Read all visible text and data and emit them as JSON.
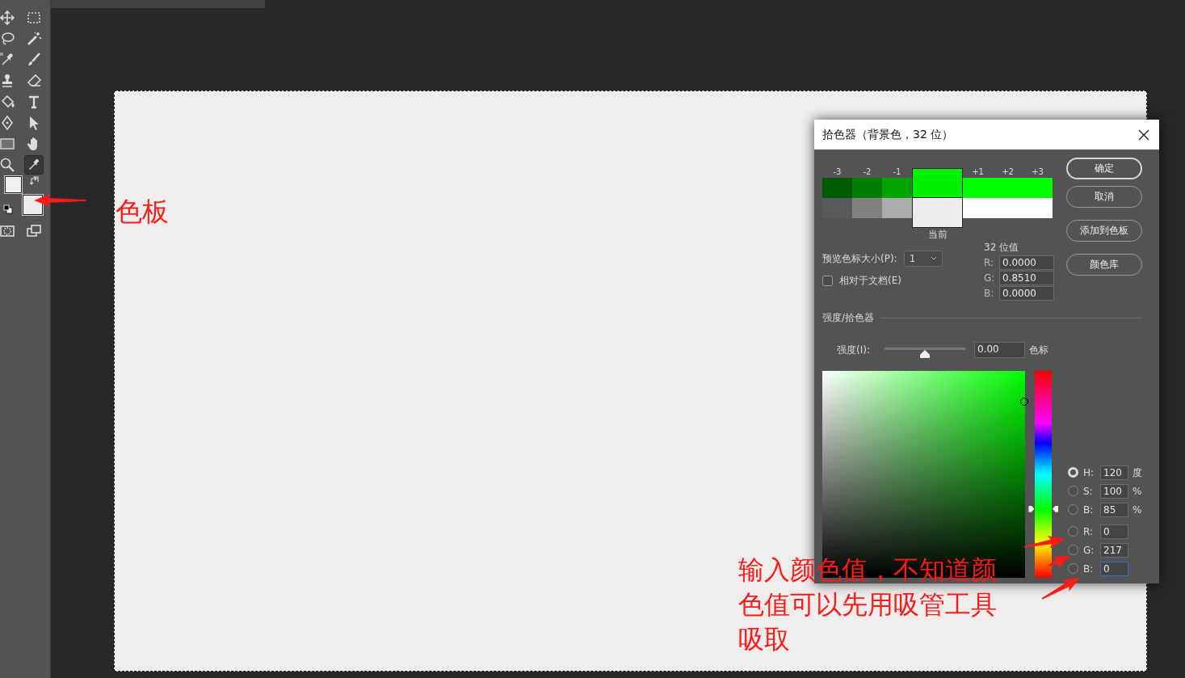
{
  "tools": [
    {
      "kind": "move",
      "selected": false
    },
    {
      "kind": "marquee",
      "selected": false
    },
    {
      "kind": "lasso",
      "selected": false
    },
    {
      "kind": "magic-wand",
      "selected": false
    },
    {
      "kind": "sampler",
      "selected": false
    },
    {
      "kind": "brush",
      "selected": false
    },
    {
      "kind": "stamp",
      "selected": false
    },
    {
      "kind": "eraser",
      "selected": false
    },
    {
      "kind": "bucket",
      "selected": false
    },
    {
      "kind": "type",
      "selected": false
    },
    {
      "kind": "pen",
      "selected": false
    },
    {
      "kind": "pointer",
      "selected": false
    },
    {
      "kind": "rectangle",
      "selected": false
    },
    {
      "kind": "hand",
      "selected": false
    },
    {
      "kind": "zoom",
      "selected": false
    },
    {
      "kind": "eyedropper",
      "selected": true
    }
  ],
  "annotations": [
    {
      "text": "色板"
    },
    {
      "text": "输入颜色值，不知道颜色值可以先用吸管工具吸取"
    }
  ],
  "color_picker": {
    "title": "拾色器（背景色，32 位）",
    "new_swatches": [
      {
        "label": "-3",
        "color": "#005a00"
      },
      {
        "label": "-2",
        "color": "#007c00"
      },
      {
        "label": "-1",
        "color": "#00a600"
      },
      {
        "color": "#00f000"
      },
      {
        "label": "+1",
        "color": "#00ff00"
      },
      {
        "label": "+2",
        "color": "#00ff00"
      },
      {
        "label": "+3",
        "color": "#00ff00"
      }
    ],
    "current_swatches": [
      {
        "color": "#595959"
      },
      {
        "color": "#808080"
      },
      {
        "color": "#adacab"
      },
      {
        "color": "#efedec"
      },
      {
        "color": "#ffffff"
      },
      {
        "color": "#ffffff"
      },
      {
        "color": "#ffffff"
      }
    ],
    "current_label": "当前",
    "preview_size": {
      "label": "预览色标大小(P):",
      "value": "1"
    },
    "relative_to_document": {
      "label": "相对于文档(E)",
      "checked": false
    },
    "bit_values": {
      "title": "32 位值",
      "fields": [
        {
          "label": "R:",
          "value": "0.0000"
        },
        {
          "label": "G:",
          "value": "0.8510"
        },
        {
          "label": "B:",
          "value": "0.0000"
        }
      ]
    },
    "buttons": [
      {
        "label": "确定",
        "default": true
      },
      {
        "label": "取消",
        "default": false
      },
      {
        "label": "添加到色板",
        "default": false
      },
      {
        "label": "颜色库",
        "default": false
      }
    ],
    "section_title": "强度/拾色器",
    "intensity": {
      "label": "强度(I):",
      "level": 0.5,
      "value": "0.00",
      "unit": "色标"
    },
    "hue_slider": {
      "level": 0.333
    },
    "fields": [
      {
        "label": "H:",
        "value": "120",
        "unit": "度",
        "selected": true,
        "focused": false
      },
      {
        "label": "S:",
        "value": "100",
        "unit": "%",
        "selected": false,
        "focused": false
      },
      {
        "label": "B:",
        "value": "85",
        "unit": "%",
        "selected": false,
        "focused": false
      },
      {
        "label": "R:",
        "value": "0",
        "selected": false,
        "focused": false
      },
      {
        "label": "G:",
        "value": "217",
        "selected": false,
        "focused": false
      },
      {
        "label": "B:",
        "value": "0",
        "selected": false,
        "focused": true
      }
    ]
  }
}
